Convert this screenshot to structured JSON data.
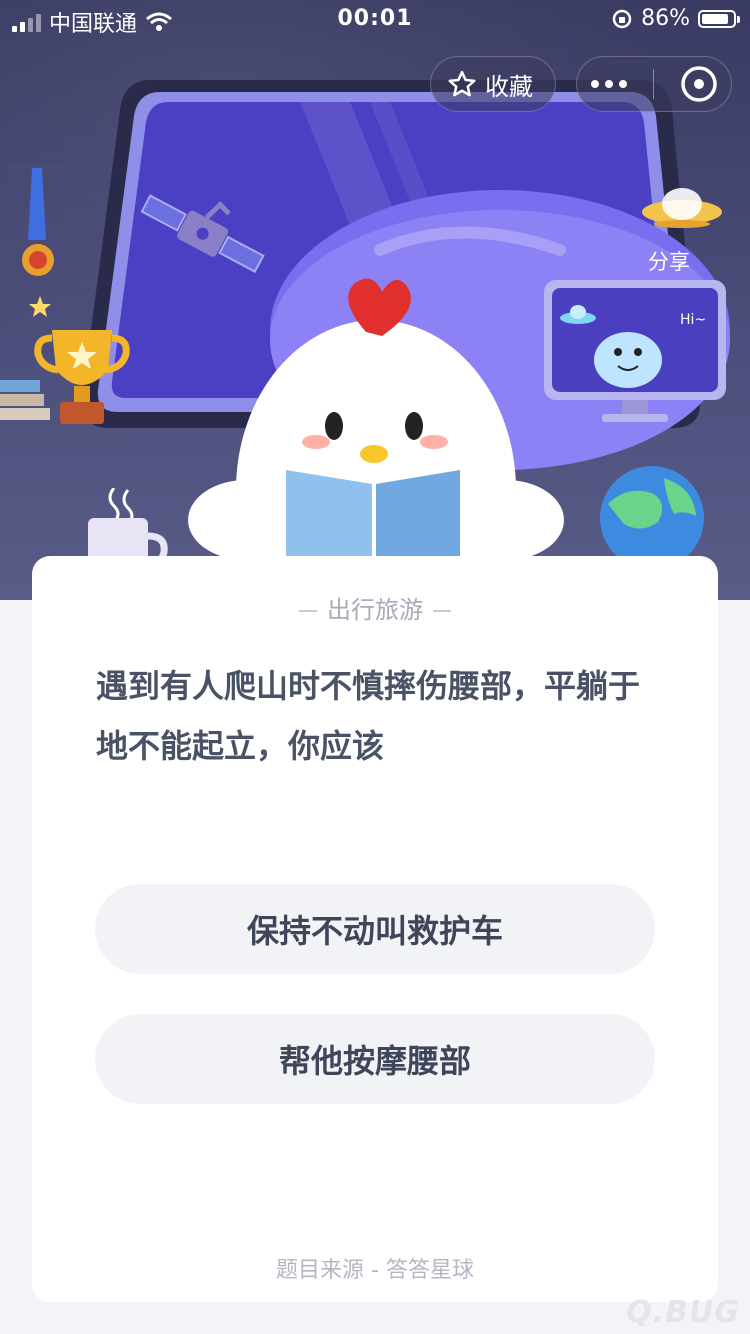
{
  "status_bar": {
    "carrier": "中国联通",
    "time": "00:01",
    "battery_percent": "86%",
    "battery_level": 0.86
  },
  "header": {
    "favorite_label": "收藏",
    "share_label": "分享",
    "menu_icon": "more-dots-icon",
    "close_icon": "close-target-icon"
  },
  "scene": {
    "speech_bubble": "Hi~"
  },
  "quiz": {
    "category": "出行旅游",
    "question": "遇到有人爬山时不慎摔伤腰部，平躺于地不能起立，你应该",
    "options": [
      {
        "label": "保持不动叫救护车"
      },
      {
        "label": "帮他按摩腰部"
      }
    ],
    "source": "题目来源 - 答答星球"
  },
  "watermark": "Q.BUG",
  "colors": {
    "accent": "#5a4fd6",
    "card_bg": "#ffffff",
    "option_bg": "#f2f3f6",
    "question_text": "#4a5266",
    "muted_text": "#a7abb8"
  }
}
